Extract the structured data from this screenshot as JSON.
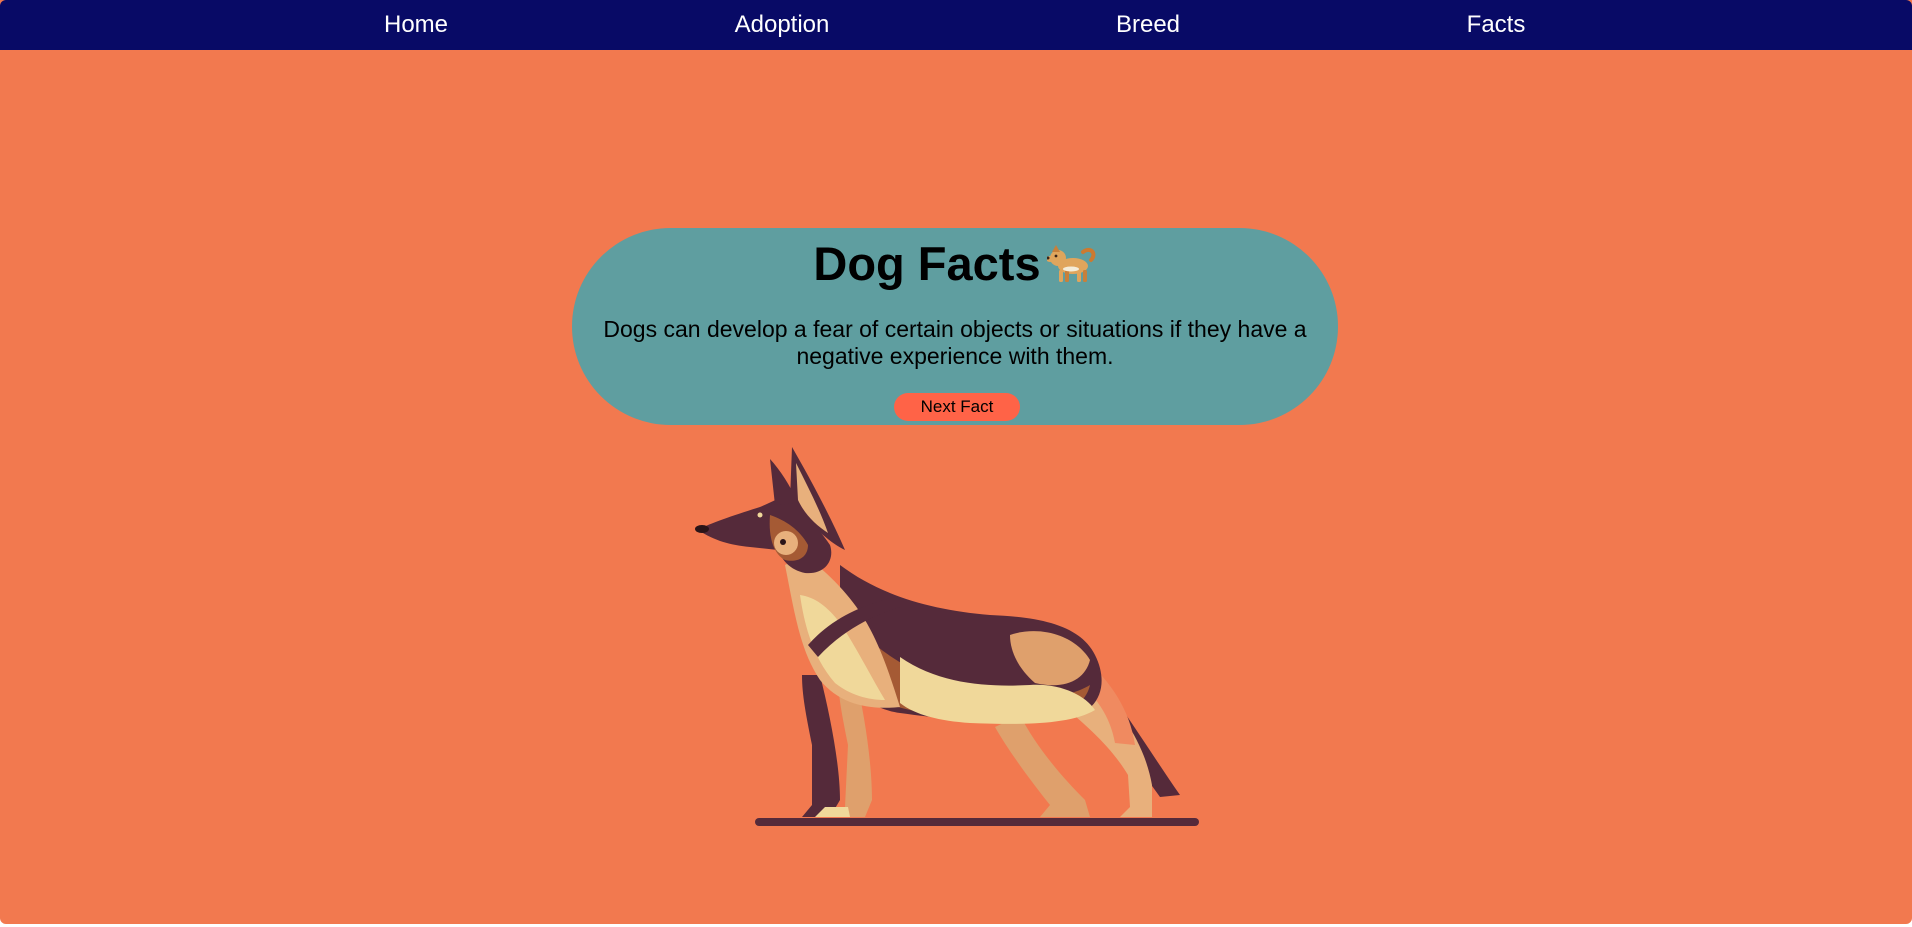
{
  "nav": {
    "items": [
      {
        "label": "Home"
      },
      {
        "label": "Adoption"
      },
      {
        "label": "Breed"
      },
      {
        "label": "Facts"
      }
    ]
  },
  "fact_card": {
    "title": "Dog Facts",
    "title_icon": "dog-emoji-icon",
    "fact_text": "Dogs can develop a fear of certain objects or situations if they have a negative experience with them.",
    "next_button_label": "Next Fact"
  },
  "illustration": {
    "icon": "german-shepherd-illustration"
  },
  "colors": {
    "page_background": "#f2794f",
    "navbar": "#080a66",
    "card": "#5f9ea0",
    "button": "#ff6347"
  }
}
